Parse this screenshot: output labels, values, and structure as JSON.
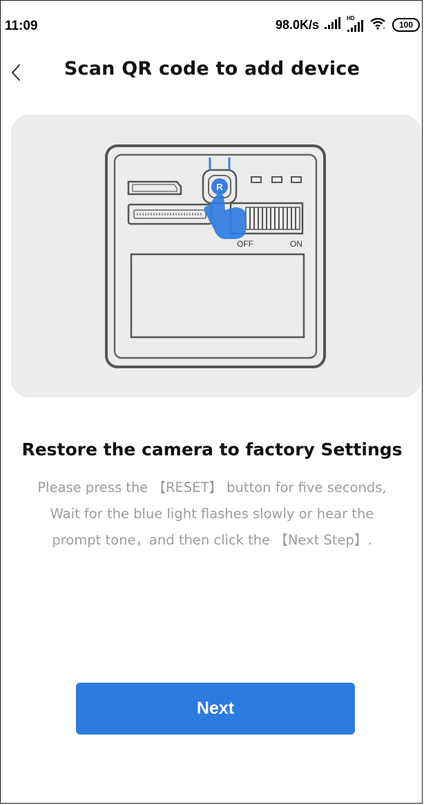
{
  "status_bar": {
    "time": "11:09",
    "network_speed": "98.0K/s",
    "signal_hd_label": "HD",
    "battery_level": "100",
    "icons": [
      "signal-icon",
      "signal-hd-icon",
      "wifi-icon",
      "battery-icon"
    ]
  },
  "header": {
    "back_icon": "chevron-left-icon",
    "title": "Scan QR code to add device"
  },
  "illustration": {
    "description_icons": [
      "camera-device-icon",
      "hand-pointer-icon"
    ],
    "switch_off_label": "OFF",
    "switch_on_label": "ON",
    "reset_button_label": "R"
  },
  "instructions": {
    "title": "Restore the camera to factory Settings",
    "lines": [
      "Please press the 【RESET】 button for five seconds,",
      "Wait for the blue light flashes slowly or hear the",
      "prompt tone，and then click the 【Next Step】."
    ]
  },
  "actions": {
    "next_label": "Next"
  },
  "colors": {
    "accent": "#2b7bdf",
    "card_background": "#ececec",
    "body_text": "#9c9c9c"
  }
}
